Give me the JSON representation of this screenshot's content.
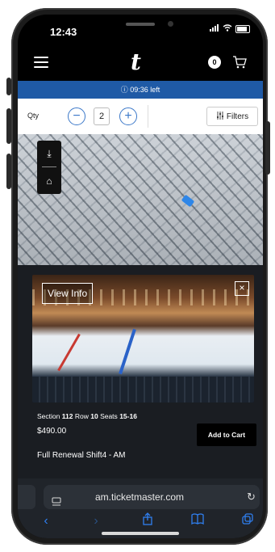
{
  "status_bar": {
    "time": "12:43"
  },
  "header": {
    "logo": "t",
    "cart_count": "0"
  },
  "timer": {
    "text": "09:36 left"
  },
  "quantity": {
    "label": "Qty",
    "value": "2",
    "minus": "−",
    "plus": "+",
    "filters_label": "Filters"
  },
  "seat_photo": {
    "view_info_label": "View Info",
    "close_label": "×"
  },
  "listing": {
    "section_label": "Section",
    "section": "112",
    "row_label": "Row",
    "row": "10",
    "seats_label": "Seats",
    "seats": "15-16",
    "price": "$490.00",
    "add_to_cart_label": "Add to Cart",
    "package_name": "Full Renewal Shift4 - AM"
  },
  "browser": {
    "url": "am.ticketmaster.com"
  },
  "colors": {
    "accent": "#1f5aa6",
    "selected_seat": "#2e86e8",
    "ios_blue": "#2f7ff0"
  }
}
